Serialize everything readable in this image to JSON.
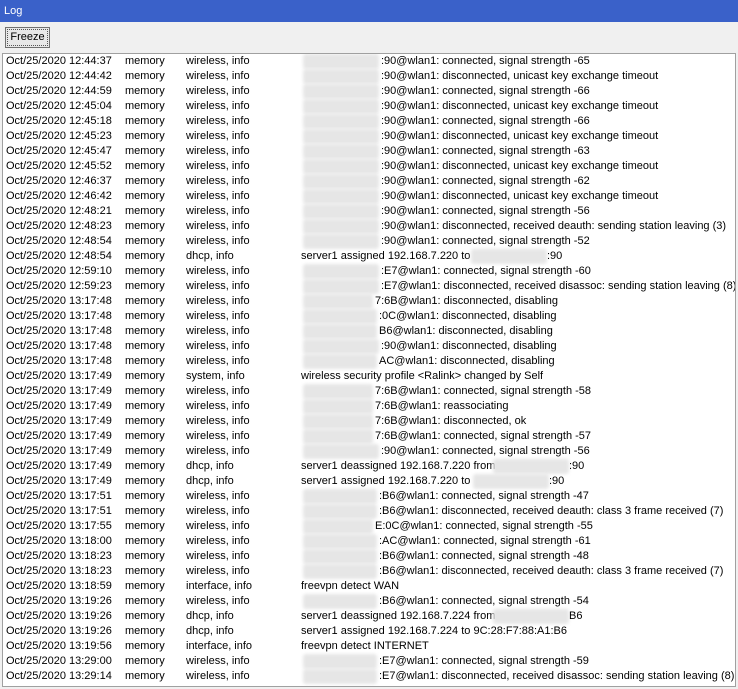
{
  "window": {
    "title": "Log"
  },
  "toolbar": {
    "freeze_label": "Freeze"
  },
  "log": {
    "rows": [
      {
        "time": "Oct/25/2020 12:44:37",
        "buffer": "memory",
        "topics": "wireless, info",
        "message": ":90@wlan1: connected, signal strength -65"
      },
      {
        "time": "Oct/25/2020 12:44:42",
        "buffer": "memory",
        "topics": "wireless, info",
        "message": ":90@wlan1: disconnected, unicast key exchange timeout"
      },
      {
        "time": "Oct/25/2020 12:44:59",
        "buffer": "memory",
        "topics": "wireless, info",
        "message": ":90@wlan1: connected, signal strength -66"
      },
      {
        "time": "Oct/25/2020 12:45:04",
        "buffer": "memory",
        "topics": "wireless, info",
        "message": ":90@wlan1: disconnected, unicast key exchange timeout"
      },
      {
        "time": "Oct/25/2020 12:45:18",
        "buffer": "memory",
        "topics": "wireless, info",
        "message": ":90@wlan1: connected, signal strength -66"
      },
      {
        "time": "Oct/25/2020 12:45:23",
        "buffer": "memory",
        "topics": "wireless, info",
        "message": ":90@wlan1: disconnected, unicast key exchange timeout"
      },
      {
        "time": "Oct/25/2020 12:45:47",
        "buffer": "memory",
        "topics": "wireless, info",
        "message": ":90@wlan1: connected, signal strength -63"
      },
      {
        "time": "Oct/25/2020 12:45:52",
        "buffer": "memory",
        "topics": "wireless, info",
        "message": ":90@wlan1: disconnected, unicast key exchange timeout"
      },
      {
        "time": "Oct/25/2020 12:46:37",
        "buffer": "memory",
        "topics": "wireless, info",
        "message": ":90@wlan1: connected, signal strength -62"
      },
      {
        "time": "Oct/25/2020 12:46:42",
        "buffer": "memory",
        "topics": "wireless, info",
        "message": ":90@wlan1: disconnected, unicast key exchange timeout"
      },
      {
        "time": "Oct/25/2020 12:48:21",
        "buffer": "memory",
        "topics": "wireless, info",
        "message": ":90@wlan1: connected, signal strength -56"
      },
      {
        "time": "Oct/25/2020 12:48:23",
        "buffer": "memory",
        "topics": "wireless, info",
        "message": ":90@wlan1: disconnected, received deauth: sending station leaving (3)"
      },
      {
        "time": "Oct/25/2020 12:48:54",
        "buffer": "memory",
        "topics": "wireless, info",
        "message": ":90@wlan1: connected, signal strength -52"
      },
      {
        "time": "Oct/25/2020 12:48:54",
        "buffer": "memory",
        "topics": "dhcp, info",
        "message": "server1 assigned 192.168.7.220 to ",
        "message_tail": ":90"
      },
      {
        "time": "Oct/25/2020 12:59:10",
        "buffer": "memory",
        "topics": "wireless, info",
        "message": ":E7@wlan1: connected, signal strength -60"
      },
      {
        "time": "Oct/25/2020 12:59:23",
        "buffer": "memory",
        "topics": "wireless, info",
        "message": ":E7@wlan1: disconnected, received disassoc: sending station leaving (8)"
      },
      {
        "time": "Oct/25/2020 13:17:48",
        "buffer": "memory",
        "topics": "wireless, info",
        "message": "7:6B@wlan1: disconnected, disabling"
      },
      {
        "time": "Oct/25/2020 13:17:48",
        "buffer": "memory",
        "topics": "wireless, info",
        "message": ":0C@wlan1: disconnected, disabling"
      },
      {
        "time": "Oct/25/2020 13:17:48",
        "buffer": "memory",
        "topics": "wireless, info",
        "message": "B6@wlan1: disconnected, disabling"
      },
      {
        "time": "Oct/25/2020 13:17:48",
        "buffer": "memory",
        "topics": "wireless, info",
        "message": ":90@wlan1: disconnected, disabling"
      },
      {
        "time": "Oct/25/2020 13:17:48",
        "buffer": "memory",
        "topics": "wireless, info",
        "message": "AC@wlan1: disconnected, disabling"
      },
      {
        "time": "Oct/25/2020 13:17:49",
        "buffer": "memory",
        "topics": "system, info",
        "message": "wireless security profile <Ralink> changed by Self"
      },
      {
        "time": "Oct/25/2020 13:17:49",
        "buffer": "memory",
        "topics": "wireless, info",
        "message": "7:6B@wlan1: connected, signal strength -58"
      },
      {
        "time": "Oct/25/2020 13:17:49",
        "buffer": "memory",
        "topics": "wireless, info",
        "message": "7:6B@wlan1: reassociating"
      },
      {
        "time": "Oct/25/2020 13:17:49",
        "buffer": "memory",
        "topics": "wireless, info",
        "message": "7:6B@wlan1: disconnected, ok"
      },
      {
        "time": "Oct/25/2020 13:17:49",
        "buffer": "memory",
        "topics": "wireless, info",
        "message": "7:6B@wlan1: connected, signal strength -57"
      },
      {
        "time": "Oct/25/2020 13:17:49",
        "buffer": "memory",
        "topics": "wireless, info",
        "message": ":90@wlan1: connected, signal strength -56"
      },
      {
        "time": "Oct/25/2020 13:17:49",
        "buffer": "memory",
        "topics": "dhcp, info",
        "message": "server1 deassigned 192.168.7.220 from ",
        "message_tail": ":90"
      },
      {
        "time": "Oct/25/2020 13:17:49",
        "buffer": "memory",
        "topics": "dhcp, info",
        "message": "server1 assigned 192.168.7.220 to ",
        "message_tail": ":90"
      },
      {
        "time": "Oct/25/2020 13:17:51",
        "buffer": "memory",
        "topics": "wireless, info",
        "message": ":B6@wlan1: connected, signal strength -47"
      },
      {
        "time": "Oct/25/2020 13:17:51",
        "buffer": "memory",
        "topics": "wireless, info",
        "message": ":B6@wlan1: disconnected, received deauth: class 3 frame received (7)"
      },
      {
        "time": "Oct/25/2020 13:17:55",
        "buffer": "memory",
        "topics": "wireless, info",
        "message": "E:0C@wlan1: connected, signal strength -55"
      },
      {
        "time": "Oct/25/2020 13:18:00",
        "buffer": "memory",
        "topics": "wireless, info",
        "message": ":AC@wlan1: connected, signal strength -61"
      },
      {
        "time": "Oct/25/2020 13:18:23",
        "buffer": "memory",
        "topics": "wireless, info",
        "message": ":B6@wlan1: connected, signal strength -48"
      },
      {
        "time": "Oct/25/2020 13:18:23",
        "buffer": "memory",
        "topics": "wireless, info",
        "message": ":B6@wlan1: disconnected, received deauth: class 3 frame received (7)"
      },
      {
        "time": "Oct/25/2020 13:18:59",
        "buffer": "memory",
        "topics": "interface, info",
        "message": "freevpn detect WAN"
      },
      {
        "time": "Oct/25/2020 13:19:26",
        "buffer": "memory",
        "topics": "wireless, info",
        "message": ":B6@wlan1: connected, signal strength -54"
      },
      {
        "time": "Oct/25/2020 13:19:26",
        "buffer": "memory",
        "topics": "dhcp, info",
        "message": "server1 deassigned 192.168.7.224 from ",
        "message_tail": "B6"
      },
      {
        "time": "Oct/25/2020 13:19:26",
        "buffer": "memory",
        "topics": "dhcp, info",
        "message": "server1 assigned 192.168.7.224 to 9C:28:F7:88:A1:B6"
      },
      {
        "time": "Oct/25/2020 13:19:56",
        "buffer": "memory",
        "topics": "interface, info",
        "message": "freevpn detect INTERNET"
      },
      {
        "time": "Oct/25/2020 13:29:00",
        "buffer": "memory",
        "topics": "wireless, info",
        "message": ":E7@wlan1: connected, signal strength -59"
      },
      {
        "time": "Oct/25/2020 13:29:14",
        "buffer": "memory",
        "topics": "wireless, info",
        "message": ":E7@wlan1: disconnected, received disassoc: sending station leaving (8)"
      }
    ]
  }
}
